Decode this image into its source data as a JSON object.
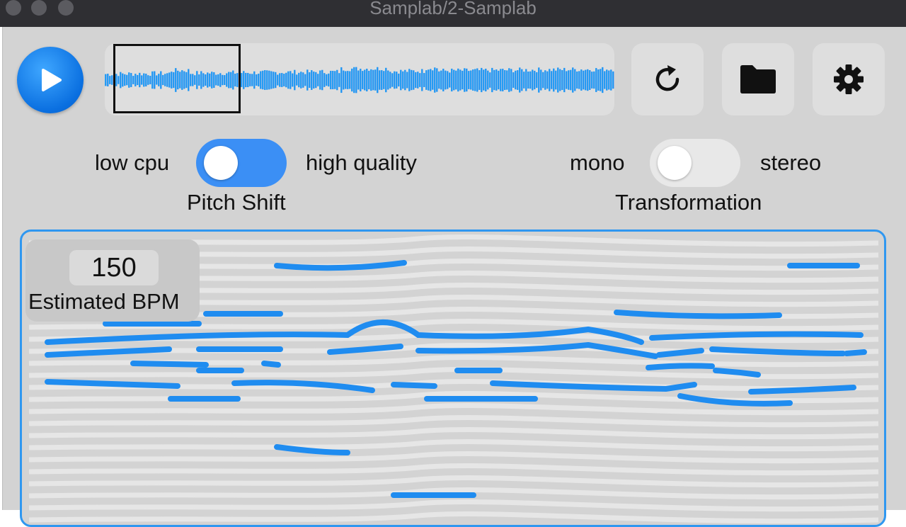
{
  "window": {
    "title": "Samplab/2-Samplab"
  },
  "toolbar": {
    "play_icon": "play-icon",
    "refresh_icon": "refresh-icon",
    "folder_icon": "folder-icon",
    "settings_icon": "gear-icon"
  },
  "pitch_shift": {
    "left_label": "low cpu",
    "right_label": "high quality",
    "title": "Pitch Shift",
    "value": "low cpu"
  },
  "transformation": {
    "left_label": "mono",
    "right_label": "stereo",
    "title": "Transformation",
    "value": "mono"
  },
  "bpm": {
    "value": "150",
    "label": "Estimated BPM"
  },
  "colors": {
    "accent": "#2f97f0",
    "toggle_on": "#3b8ff5",
    "background": "#d3d3d3"
  }
}
